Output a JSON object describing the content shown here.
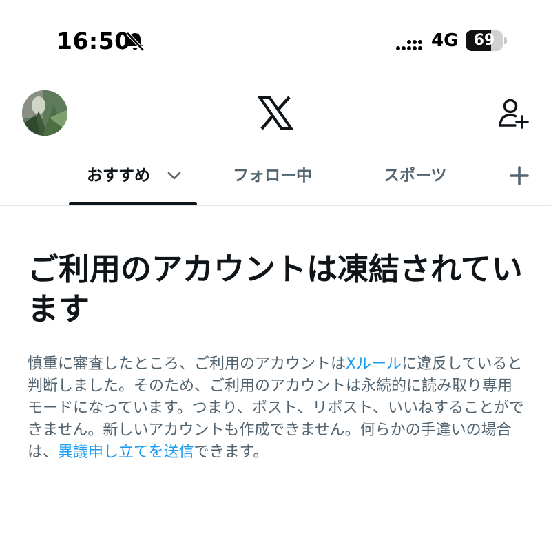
{
  "status_bar": {
    "time": "16:50",
    "network": "4G",
    "battery": "69",
    "battery_level": 0.69,
    "bell_icon": "bell-slash-icon",
    "signal_icon": "signal-dots-icon"
  },
  "header": {
    "avatar_icon": "profile-avatar",
    "logo_icon": "x-logo-icon",
    "add_user_icon": "person-add-icon"
  },
  "tabs": [
    {
      "label": "おすすめ",
      "active": true
    },
    {
      "label": "フォロー中",
      "active": false
    },
    {
      "label": "スポーツ",
      "active": false
    }
  ],
  "tab_icons": {
    "chevron": "chevron-down-icon",
    "add": "plus-icon"
  },
  "notice": {
    "title": "ご利用のアカウントは凍結されています",
    "body_part1": "慎重に審査したところ、ご利用のアカウントは",
    "rules_link": "Xルール",
    "body_part2": "に違反していると判断しました。そのため、ご利用のアカウントは永続的に読み取り専用モードになっています。つまり、ポスト、リポスト、いいねすることができません。新しいアカウントも作成できません。何らかの手違いの場合は、",
    "appeal_link": "異議申し立てを送信",
    "body_part3": "できます。"
  },
  "colors": {
    "text_primary": "#0f1419",
    "text_secondary": "#536471",
    "link": "#1d9bf0",
    "divider": "#e3e6e9"
  }
}
